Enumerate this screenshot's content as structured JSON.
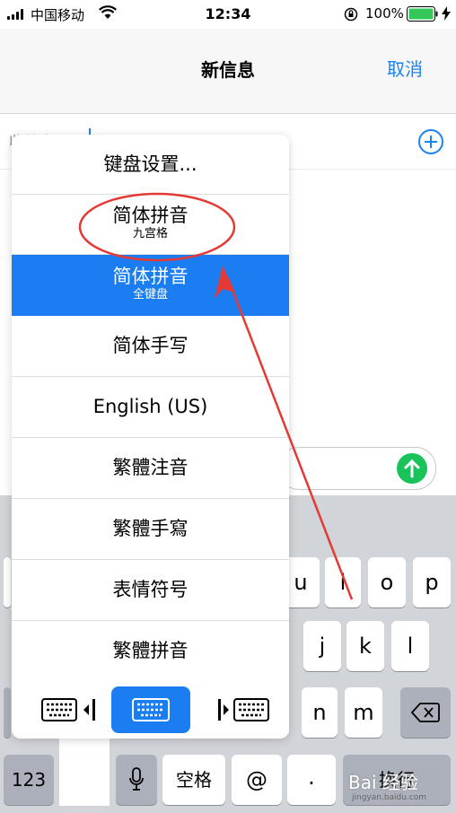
{
  "status_bar": {
    "carrier": "中国移动",
    "time": "12:34",
    "battery_percent": "100%"
  },
  "nav": {
    "title": "新信息",
    "cancel_label": "取消"
  },
  "compose": {
    "to_label": "收件人:"
  },
  "input_menu": {
    "settings_label": "键盘设置...",
    "items": [
      {
        "label": "简体拼音",
        "sub": "九宫格"
      },
      {
        "label": "简体拼音",
        "sub": "全键盘"
      },
      {
        "label": "简体手写",
        "sub": ""
      },
      {
        "label": "English (US)",
        "sub": ""
      },
      {
        "label": "繁體注音",
        "sub": ""
      },
      {
        "label": "繁體手寫",
        "sub": ""
      },
      {
        "label": "表情符号",
        "sub": ""
      },
      {
        "label": "繁體拼音",
        "sub": ""
      }
    ],
    "selected_index": 1
  },
  "keyboard": {
    "row1": [
      "u",
      "i",
      "o",
      "p"
    ],
    "row2": [
      "j",
      "k",
      "l"
    ],
    "row3": [
      "n",
      "m"
    ],
    "num_label": "123",
    "space_label": "空格",
    "at_label": "@",
    "dot_label": ".",
    "return_label": "换行"
  },
  "watermark": {
    "brand": "Bai 经验",
    "site": "jingyan.baidu.com"
  },
  "colors": {
    "accent": "#1a82f4",
    "selected": "#1a7ef2",
    "send": "#19c35a",
    "annotation": "#e53935",
    "keyboard_bg": "#d1d4d9"
  }
}
